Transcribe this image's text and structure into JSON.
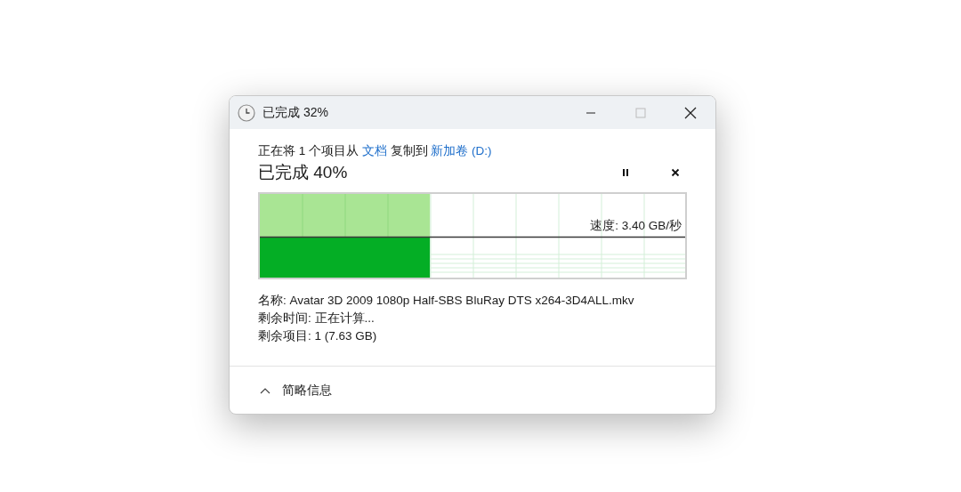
{
  "window": {
    "title": "已完成 32%"
  },
  "description": {
    "prefix": "正在将 1 个项目从",
    "source": "文档",
    "middle": "复制到",
    "destination": "新加卷 (D:)"
  },
  "progress": {
    "heading": "已完成 40%",
    "level": 0.4,
    "speed": "速度: 3.40 GB/秒"
  },
  "details": [
    "名称: Avatar 3D 2009 1080p Half-SBS BluRay DTS x264-3D4ALL.mkv",
    "剩余时间: 正在计算...",
    "剩余项目: 1 (7.63 GB)"
  ],
  "footer": {
    "label": "简略信息",
    "expanded": true
  }
}
